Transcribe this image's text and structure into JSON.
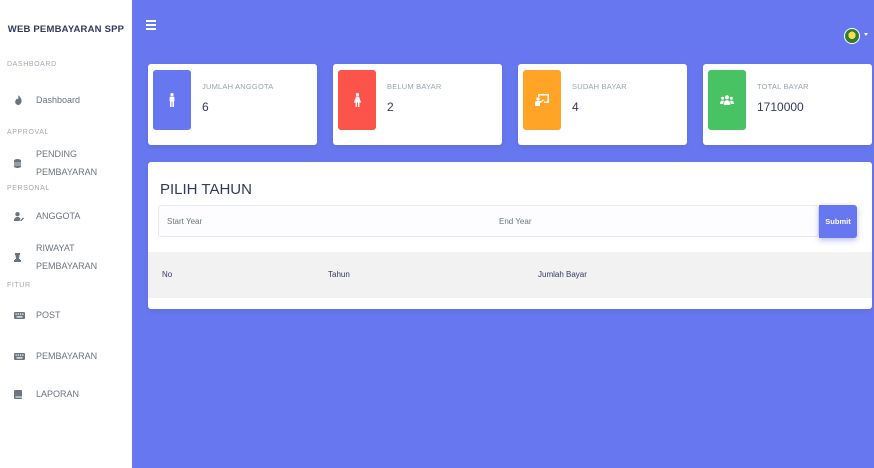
{
  "sidebar": {
    "brand": "WEB PEMBAYARAN SPP",
    "sections": [
      {
        "header": "DASHBOARD",
        "items": [
          {
            "label_lines": [
              "Dashboard"
            ],
            "icon": "fire-icon"
          }
        ]
      },
      {
        "header": "APPROVAL",
        "items": [
          {
            "label_lines": [
              "PENDING",
              "PEMBAYARAN"
            ],
            "icon": "database-icon"
          }
        ]
      },
      {
        "header": "PERSONAL",
        "items": [
          {
            "label_lines": [
              "ANGGOTA"
            ],
            "icon": "user-edit-icon"
          },
          {
            "label_lines": [
              "RIWAYAT",
              "PEMBAYARAN"
            ],
            "icon": "chess-icon"
          }
        ]
      },
      {
        "header": "FITUR",
        "items": [
          {
            "label_lines": [
              "POST"
            ],
            "icon": "keyboard-icon"
          },
          {
            "label_lines": [
              "PEMBAYARAN"
            ],
            "icon": "keyboard-icon"
          },
          {
            "label_lines": [
              "LAPORAN"
            ],
            "icon": "book-icon"
          }
        ]
      }
    ]
  },
  "cards": [
    {
      "title": "JUMLAH ANGGOTA",
      "value": "6",
      "color": "#6777ef",
      "icon": "male-icon"
    },
    {
      "title": "BELUM BAYAR",
      "value": "2",
      "color": "#fc544b",
      "icon": "female-icon"
    },
    {
      "title": "SUDAH BAYAR",
      "value": "4",
      "color": "#ffa426",
      "icon": "chalkboard-teacher-icon"
    },
    {
      "title": "TOTAL BAYAR",
      "value": "1710000",
      "color": "#47c363",
      "icon": "users-icon"
    }
  ],
  "panel": {
    "title": "PILIH TAHUN",
    "start_placeholder": "Start Year",
    "end_placeholder": "End Year",
    "submit_label": "Submit",
    "columns": [
      "No",
      "Tahun",
      "Jumlah Bayar"
    ]
  },
  "colors": {
    "primary": "#6777ef",
    "sidebar_bg": "#ffffff"
  }
}
